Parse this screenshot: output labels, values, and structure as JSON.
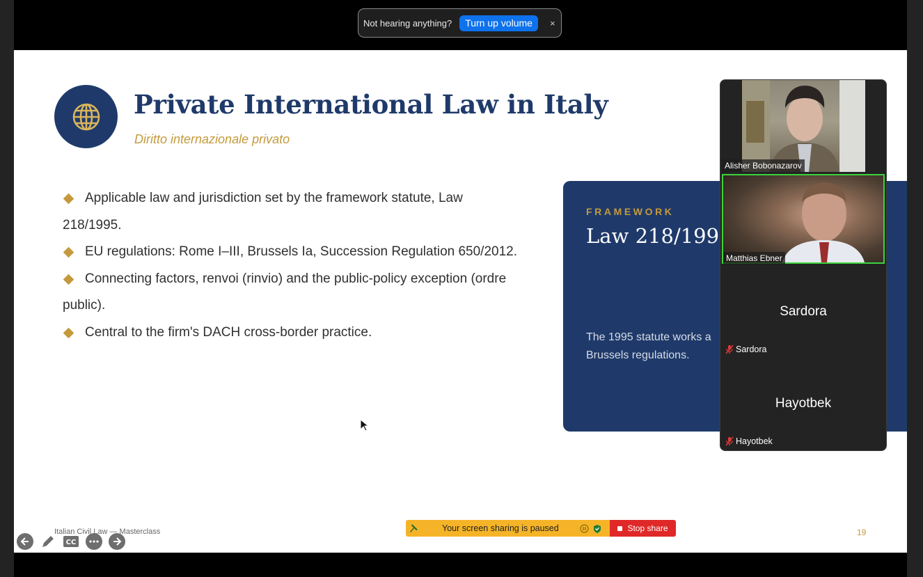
{
  "toast": {
    "message": "Not hearing anything?",
    "button": "Turn up volume",
    "close": "×"
  },
  "slide": {
    "title": "Private International Law in Italy",
    "subtitle": "Diritto internazionale privato",
    "bullets": [
      {
        "line1": "Applicable law and jurisdiction set by the framework statute, Law",
        "line2": "218/1995."
      },
      {
        "line1": "EU regulations: Rome I–III, Brussels Ia, Succession Regulation 650/2012.",
        "line2": ""
      },
      {
        "line1": "Connecting factors, renvoi (rinvio) and the public-policy exception (ordre",
        "line2": "public)."
      },
      {
        "line1": "Central to the firm's DACH cross-border practice.",
        "line2": ""
      }
    ],
    "panel": {
      "kicker": "FRAMEWORK",
      "value": "Law 218/1995",
      "note_line1": "The 1995 statute works a",
      "note_line2": "Brussels regulations."
    },
    "footer": "Italian Civil Law — Masterclass",
    "page_number": "19",
    "accent_color": "#c49a3c",
    "navy_color": "#1f3a6a"
  },
  "share_bar": {
    "message": "Your screen sharing is paused",
    "stop_label": "Stop share"
  },
  "participants": [
    {
      "name": "Alisher Bobonazarov",
      "video": true
    },
    {
      "name": "Matthias Ebner",
      "video": true,
      "active_speaker": true
    },
    {
      "name": "Sardora",
      "video": false,
      "muted": true
    },
    {
      "name": "Hayotbek",
      "video": false,
      "muted": true
    }
  ]
}
